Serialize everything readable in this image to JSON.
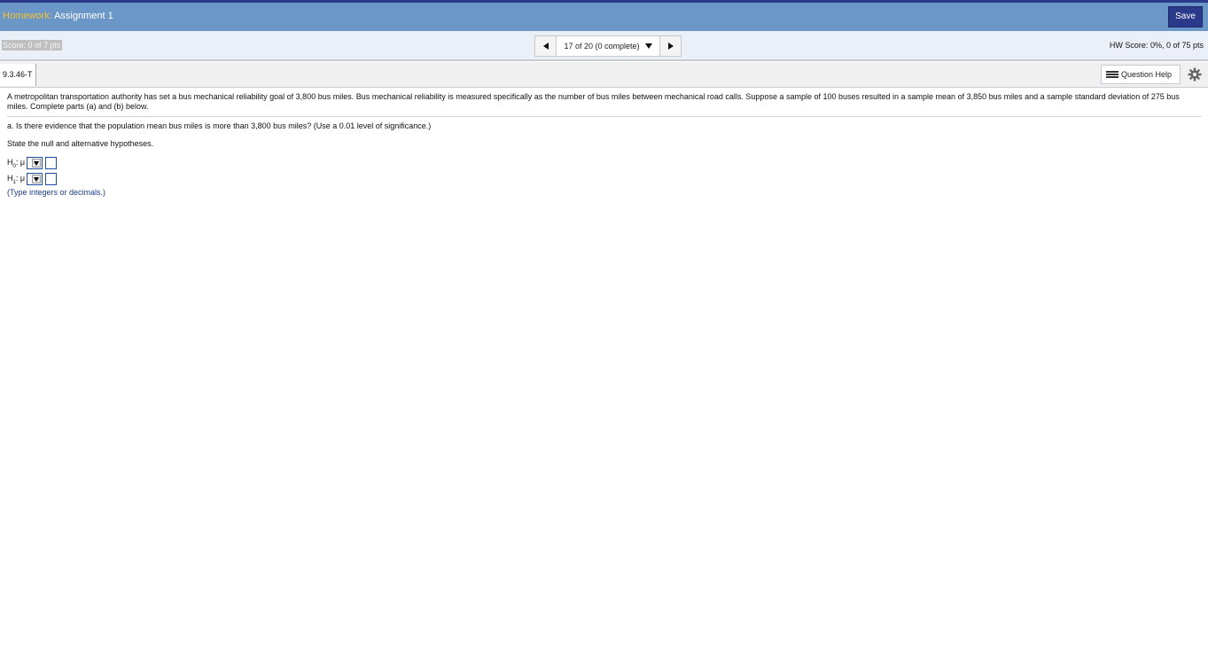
{
  "header": {
    "title_prefix": "Homework:",
    "title": "Assignment 1",
    "save_label": "Save"
  },
  "scorebar": {
    "score": "Score: 0 of 7 pts",
    "pager_text": "17 of 20 (0 complete)",
    "hw_score_label": "HW Score:",
    "hw_score_value": "0%, 0 of 75 pts"
  },
  "question": {
    "id": "9.3.46-T",
    "help_label": "Question Help"
  },
  "content": {
    "problem": "A metropolitan transportation authority has set a bus mechanical reliability goal of 3,800 bus miles. Bus mechanical reliability is measured specifically as the number of bus miles between mechanical road calls. Suppose a sample of 100 buses resulted in a sample mean of 3,850 bus miles and a sample standard deviation of 275 bus miles. Complete parts (a) and (b) below.",
    "part_a": "a. Is there evidence that the population mean bus miles is more than 3,800 bus miles? (Use a 0.01 level of significance.)",
    "instruction": "State the null and alternative hypotheses.",
    "h0_label": "H",
    "h0_sub": "0",
    "h1_label": "H",
    "h1_sub": "1",
    "mu": ": μ",
    "note": "(Type integers or decimals.)"
  },
  "colors": {
    "header_bg": "#6b97c8",
    "header_accent": "#f2c230",
    "save_bg": "#2b3a8a",
    "input_border": "#1e4fa8"
  },
  "icons": [
    "left-triangle-icon",
    "chevron-down-icon",
    "right-triangle-icon",
    "list-icon",
    "gear-icon"
  ]
}
